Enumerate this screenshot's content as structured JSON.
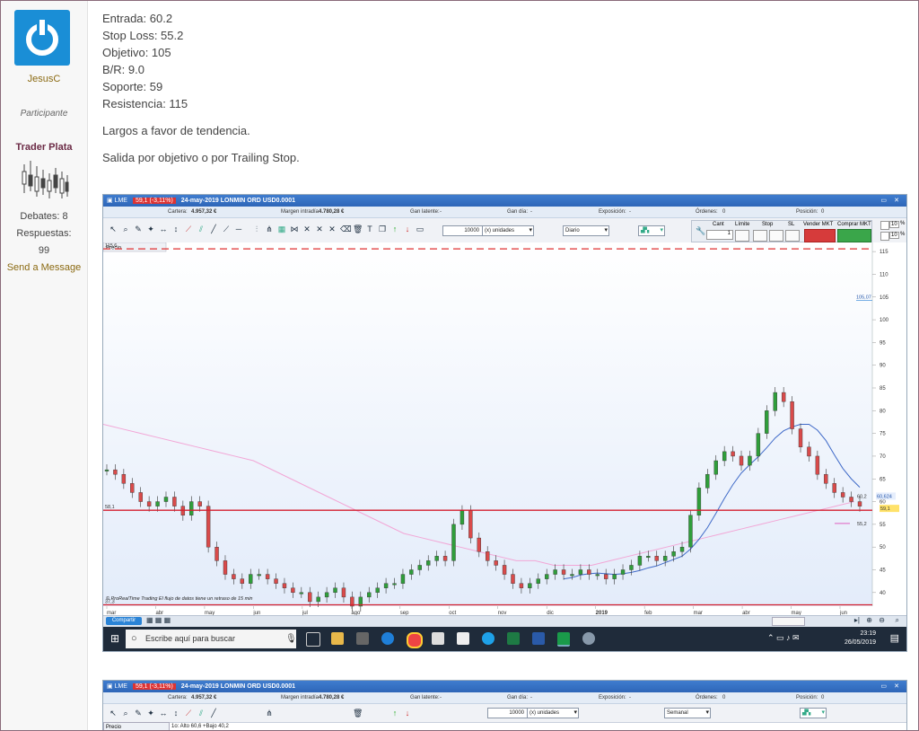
{
  "sidebar": {
    "username": "JesusC",
    "role": "Participante",
    "rank": "Trader Plata",
    "debates_label": "Debates: 8",
    "respuestas_label": "Respuestas:",
    "respuestas_value": "99",
    "send_message": "Send a Message"
  },
  "post": {
    "lines": [
      "Entrada: 60.2",
      "Stop Loss: 55.2",
      "Objetivo: 105",
      "B/R: 9.0",
      "Soporte: 59",
      "Resistencia: 115"
    ],
    "para1": "Largos a favor de tendencia.",
    "para2": "Salida por objetivo o por Trailing Stop."
  },
  "platform": {
    "title_symbol": "LME",
    "title_change": "59,1 (-3,11%)",
    "title_desc": "24-may-2019 LONMIN ORD USD0.0001",
    "account": {
      "cartera_label": "Cartera:",
      "cartera_value": "4.957,32 €",
      "margen_label": "Margen intradía",
      "margen_value": "4.780,28 €",
      "latente_label": "Gan latente:",
      "latente_value": "-",
      "dia_label": "Gan día:",
      "dia_value": "-",
      "exposicion_label": "Exposición:",
      "exposicion_value": "-",
      "ordenes_label": "Órdenes:",
      "ordenes_value": "0",
      "posicion_label": "Posición:",
      "posicion_value": "0"
    },
    "qty_value": "10000",
    "units_value": "(x) unidades",
    "period_value": "Diario",
    "order_labels": {
      "cant": "Cant",
      "limite": "Límite",
      "stop": "Stop",
      "sl": "SL",
      "vender": "Vender MKT",
      "comprar": "Comprar MKT",
      "qty": "1",
      "pct1": "%",
      "pct2": "%",
      "v0a": "0",
      "v0b": "0",
      "v10a": "10",
      "v10b": "10"
    },
    "chart_label": "Precio",
    "footer_note": "© ProRealTime Trading  El flujo de datos tiene un retraso de 15 min",
    "share_label": "Compartir",
    "taskbar_search": "Escribe aquí para buscar",
    "clock_time": "23:19",
    "clock_date": "26/05/2019",
    "chart2_label": "Precio",
    "chart2_info": "1o: Alto 60,6 +Bajo 40,2",
    "period2_value": "Semanal",
    "qty2_value": "10000",
    "units2_value": "(x) unidades"
  },
  "chart_data": {
    "type": "line",
    "x_labels": [
      "mar",
      "abr",
      "may",
      "jun",
      "jul",
      "ago",
      "sep",
      "oct",
      "nov",
      "dic",
      "2019",
      "feb",
      "mar",
      "abr",
      "may",
      "jun"
    ],
    "y_ticks": [
      40,
      45,
      50,
      55,
      60,
      65,
      70,
      75,
      80,
      85,
      90,
      95,
      100,
      105,
      110,
      115
    ],
    "ylim": [
      37,
      117
    ],
    "price_close": [
      67,
      66,
      64,
      62,
      60,
      59,
      60,
      61,
      59,
      57,
      60,
      59,
      50,
      47,
      44,
      43,
      42,
      44,
      44,
      43,
      42,
      41,
      40,
      40,
      38,
      39,
      40,
      41,
      39,
      37,
      39,
      40,
      41,
      42,
      42,
      44,
      45,
      46,
      47,
      48,
      47,
      55,
      58,
      52,
      49,
      47,
      46,
      44,
      42,
      41,
      42,
      43,
      44,
      45,
      44,
      44,
      45,
      44,
      44,
      43,
      44,
      45,
      46,
      48,
      48,
      47,
      48,
      49,
      50,
      57,
      63,
      66,
      69,
      71,
      70,
      68,
      70,
      75,
      80,
      84,
      82,
      76,
      72,
      70,
      66,
      64,
      62,
      61,
      60,
      59
    ],
    "sma": [
      77,
      76,
      75,
      74,
      73,
      72,
      71,
      70,
      69,
      67,
      65,
      63,
      61,
      59,
      57,
      55,
      53,
      52,
      51,
      50,
      49,
      48,
      47,
      47,
      46,
      46,
      46,
      47,
      48,
      49,
      50,
      51,
      52,
      53,
      54,
      55,
      56,
      57,
      58,
      59,
      60
    ],
    "lines": {
      "resistance": 115.6,
      "target": 105.07,
      "support": 58.1,
      "bottom": 37.3,
      "stop": 55.2,
      "entry": 60.2,
      "last_price": 59.1,
      "ma_value": 60.624
    },
    "level_labels": {
      "resistance": "115,6",
      "target": "105,07",
      "support": "58,1",
      "bottom": "37,3",
      "stop": "55,2",
      "entry": "60,2",
      "last_price": "59,1",
      "ma_value": "60,624"
    },
    "colors": {
      "resistance": "#e03030",
      "support": "#d41e2e",
      "bull": "#2f9e3a",
      "bear": "#d94a4a",
      "ma_long": "#f2a6d6",
      "ma_short": "#3f6ac8",
      "stop": "#e060c0"
    }
  }
}
